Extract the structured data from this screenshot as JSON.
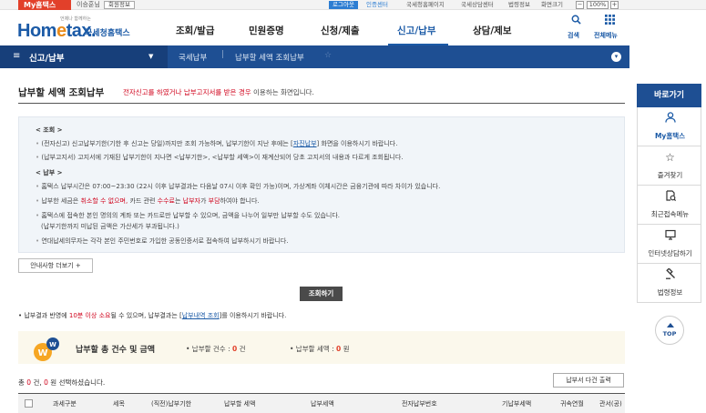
{
  "topbar": {
    "my_tab": "My홈택스",
    "user": "이승훈님",
    "logout": "회원정보",
    "login_center": "로그아웃",
    "cert_center": "인증센터",
    "links": [
      "국세청홈페이지",
      "국세상담센터",
      "법령정보",
      "화면크기"
    ],
    "zoom_minus": "−",
    "zoom_value": "100%",
    "zoom_plus": "+"
  },
  "header": {
    "logo_small": "언제나 함께하는",
    "logo_main_a": "Hom",
    "logo_main_e": "e",
    "logo_main_b": "tax.",
    "logo_kr": "국세청홈택스",
    "nav": [
      "조회/발급",
      "민원증명",
      "신청/제출",
      "신고/납부",
      "상담/제보"
    ],
    "search_label": "검색",
    "allmenu_label": "전체메뉴"
  },
  "subnav": {
    "section": "신고/납부",
    "crumb1": "국세납부",
    "crumb2": "납부할 세액 조회납부"
  },
  "page": {
    "title": "납부할 세액 조회납부",
    "sub_red": "전자신고를 하였거나 납부고지서를 받은 경우",
    "sub_rest": " 이용하는 화면입니다."
  },
  "info": {
    "h1": "< 조회 >",
    "l1a": "(전자신고) 신고납부기한(기한 후 신고는 당일)까지만 조회 가능하며, 납부기한이 지난 후에는 [",
    "l1link": "자진납부",
    "l1b": "] 화면을 이용하시기 바랍니다.",
    "l2": "(납부고지서) 고지서에 기재된 납부기한이 지나면 <납부기한>, <납부할 세액>이 재계산되어 당초 고지서의 내용과 다르게 조회됩니다.",
    "h2": "< 납부 >",
    "l3": "홈택스 납부시간은 07:00~23:30 (22시 이후 납부결과는 다음날 07시 이후 확인 가능)이며, 가상계좌 이체시간은 금융기관에 따라 차이가 있습니다.",
    "l4a": "납부한 세금은 ",
    "l4red1": "취소할 수 없으며,",
    "l4b": " 카드 관련 ",
    "l4red2": "수수료",
    "l4c": "는 ",
    "l4red3": "납부자",
    "l4d": "가 ",
    "l4red4": "부담",
    "l4e": "하여야 합니다.",
    "l5": "홈택스에 접속한 본인 명의의 계좌 또는 카드로만 납부할 수 있으며, 금액을 나누어 일부만 납부할 수도 있습니다.",
    "l6": "(납부기한까지 미납된 금액은 가산세가 부과됩니다.)",
    "l7": "연대납세의무자는 각각 본인 주민번호로 가입한 공동인증서로 접속하여 납부하시기 바랍니다."
  },
  "buttons": {
    "more": "안내사항 더보기 +",
    "search": "조회하기",
    "print": "납부서 다건 출력"
  },
  "notice": {
    "a": "• 납부결과 반영에 ",
    "red": "10분 이상 소요",
    "b": "될 수 있으며, 납부결과는 [",
    "link": "납부내역 조회",
    "c": "]를 이용하시기 바랍니다."
  },
  "summary": {
    "title": "납부할 총 건수 및 금액",
    "count_label": "• 납부할 건수 : ",
    "count_value": "0",
    "count_unit": " 건",
    "amount_label": "• 납부할 세액 : ",
    "amount_value": "0",
    "amount_unit": " 원"
  },
  "total": {
    "a": "총 ",
    "count": "0",
    "b": " 건, ",
    "amount": "0",
    "c": " 원 선택하셨습니다."
  },
  "table": {
    "headers": [
      "과세구분",
      "세목",
      "(직전)납부기한",
      "납부할 세액",
      "납부세액",
      "전자납부번호",
      "기납부세액",
      "귀속연월",
      "관서(공)"
    ]
  },
  "quick": {
    "title": "바로가기",
    "items": [
      {
        "label": "My홈택스",
        "icon": "person-icon"
      },
      {
        "label": "즐겨찾기",
        "icon": "star-icon"
      },
      {
        "label": "최근접속메뉴",
        "icon": "recent-icon"
      },
      {
        "label": "인터넷상담하기",
        "icon": "monitor-icon"
      },
      {
        "label": "법령정보",
        "icon": "gavel-icon"
      }
    ],
    "top": "TOP"
  },
  "colors": {
    "brand_blue": "#1e4f93",
    "accent_red": "#d0021b",
    "logo_orange": "#e98b1a"
  }
}
